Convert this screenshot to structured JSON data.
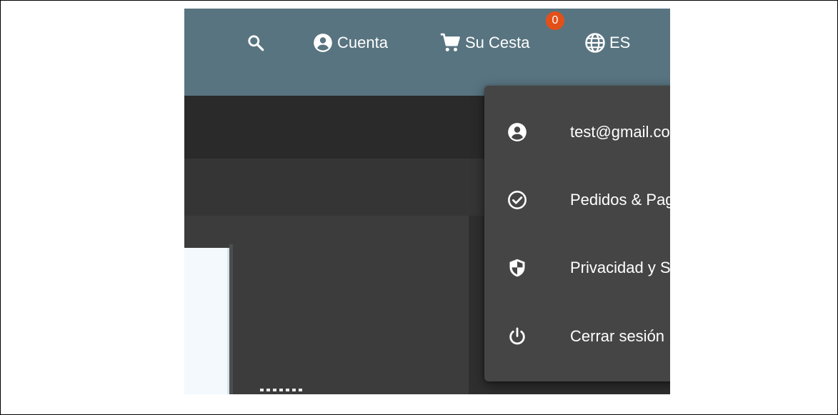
{
  "header": {
    "account_label": "Cuenta",
    "cart_label": "Su Cesta",
    "cart_count": "0",
    "language_label": "ES",
    "badge_color": "#e2501a",
    "bar_color": "#587480"
  },
  "icons": {
    "search": "search-icon",
    "account": "account-circle-icon",
    "cart": "shopping-cart-icon",
    "language": "globe-icon"
  },
  "account_menu": {
    "items": [
      {
        "label": "test@gmail.com",
        "icon": "account-circle-icon",
        "has_submenu": false
      },
      {
        "label": "Pedidos & Pagos",
        "icon": "check-circle-icon",
        "has_submenu": true
      },
      {
        "label": "Privacidad y Seguridad",
        "icon": "shield-icon",
        "has_submenu": true
      },
      {
        "label": "Cerrar sesión",
        "icon": "power-icon",
        "has_submenu": false
      }
    ]
  }
}
